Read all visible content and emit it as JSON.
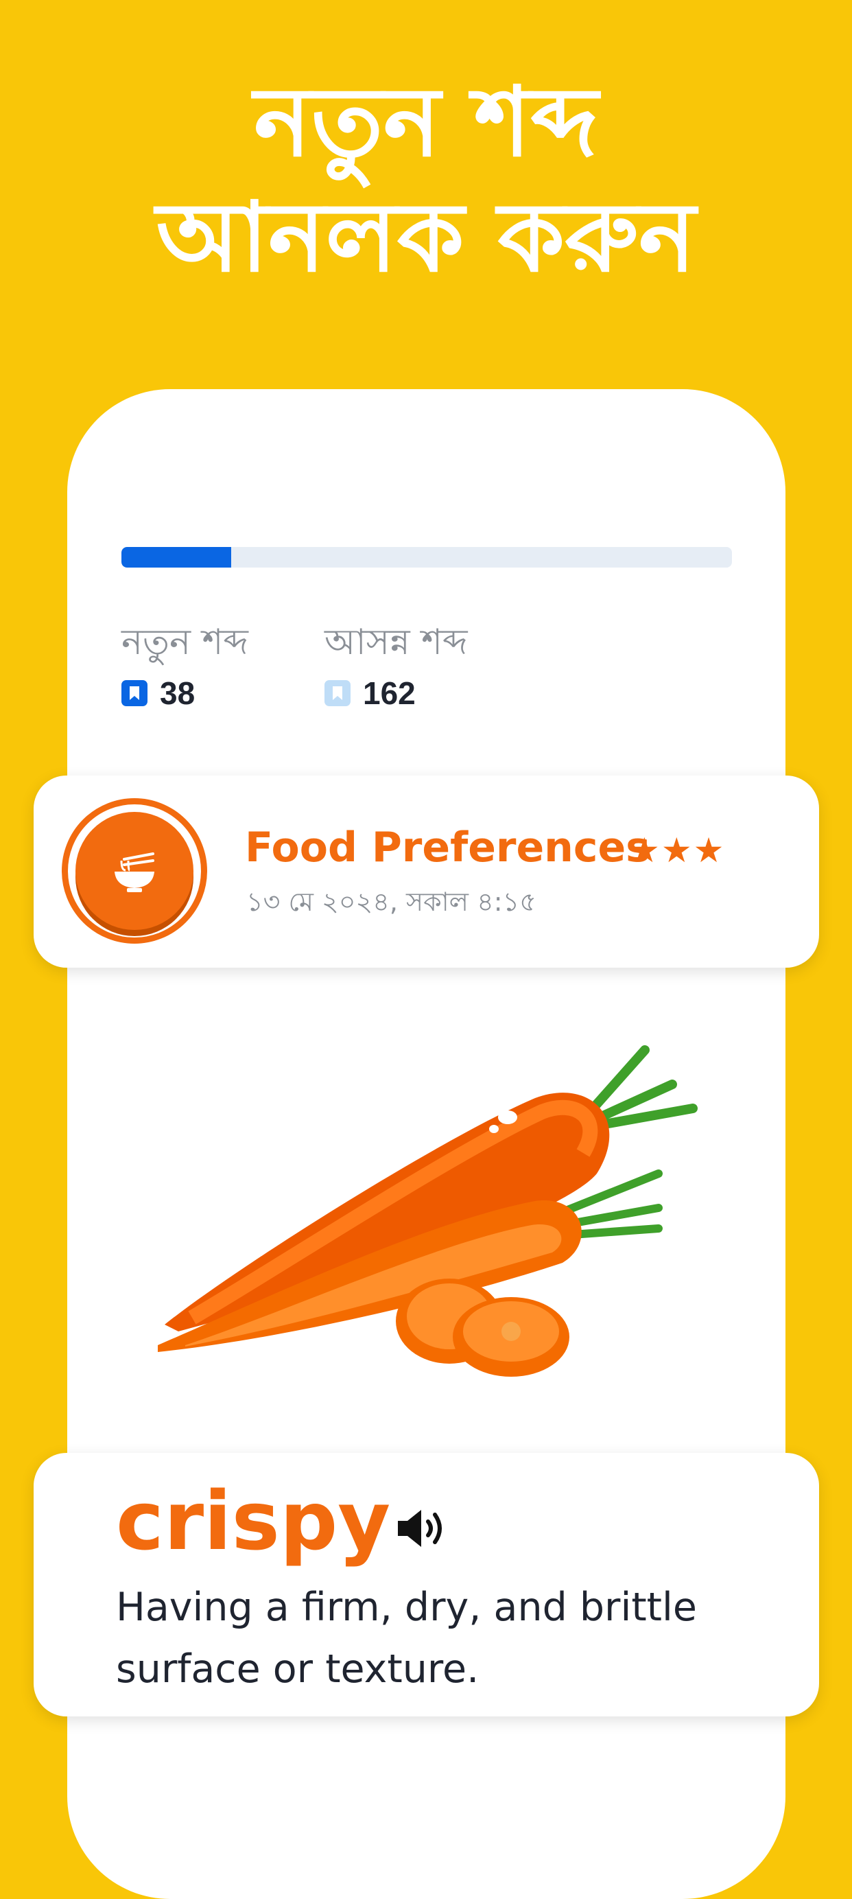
{
  "header": {
    "line1": "নতুন শব্দ",
    "line2": "আনলক করুন"
  },
  "progress": {
    "fraction": 0.18
  },
  "stats": {
    "new_words": {
      "label": "নতুন শব্দ",
      "value": "38",
      "icon": "bookmark-icon",
      "color": "#0A66E3"
    },
    "upcoming_words": {
      "label": "আসন্ন শব্দ",
      "value": "162",
      "icon": "bookmark-icon",
      "color": "#BFDDF7"
    }
  },
  "topic": {
    "title": "Food Preferences",
    "stars": "★★★",
    "rating": 3,
    "date": "১৩ মে ২০২৪, সকাল ৪:১৫",
    "icon": "noodle-bowl-icon"
  },
  "image": {
    "icon": "carrot-illustration"
  },
  "word_card": {
    "word": "crispy",
    "definition": "Having a firm, dry, and brittle surface or texture.",
    "audio_icon": "speaker-icon"
  },
  "colors": {
    "background": "#F9C608",
    "accent": "#F26B0F",
    "progress": "#0A66E3"
  }
}
